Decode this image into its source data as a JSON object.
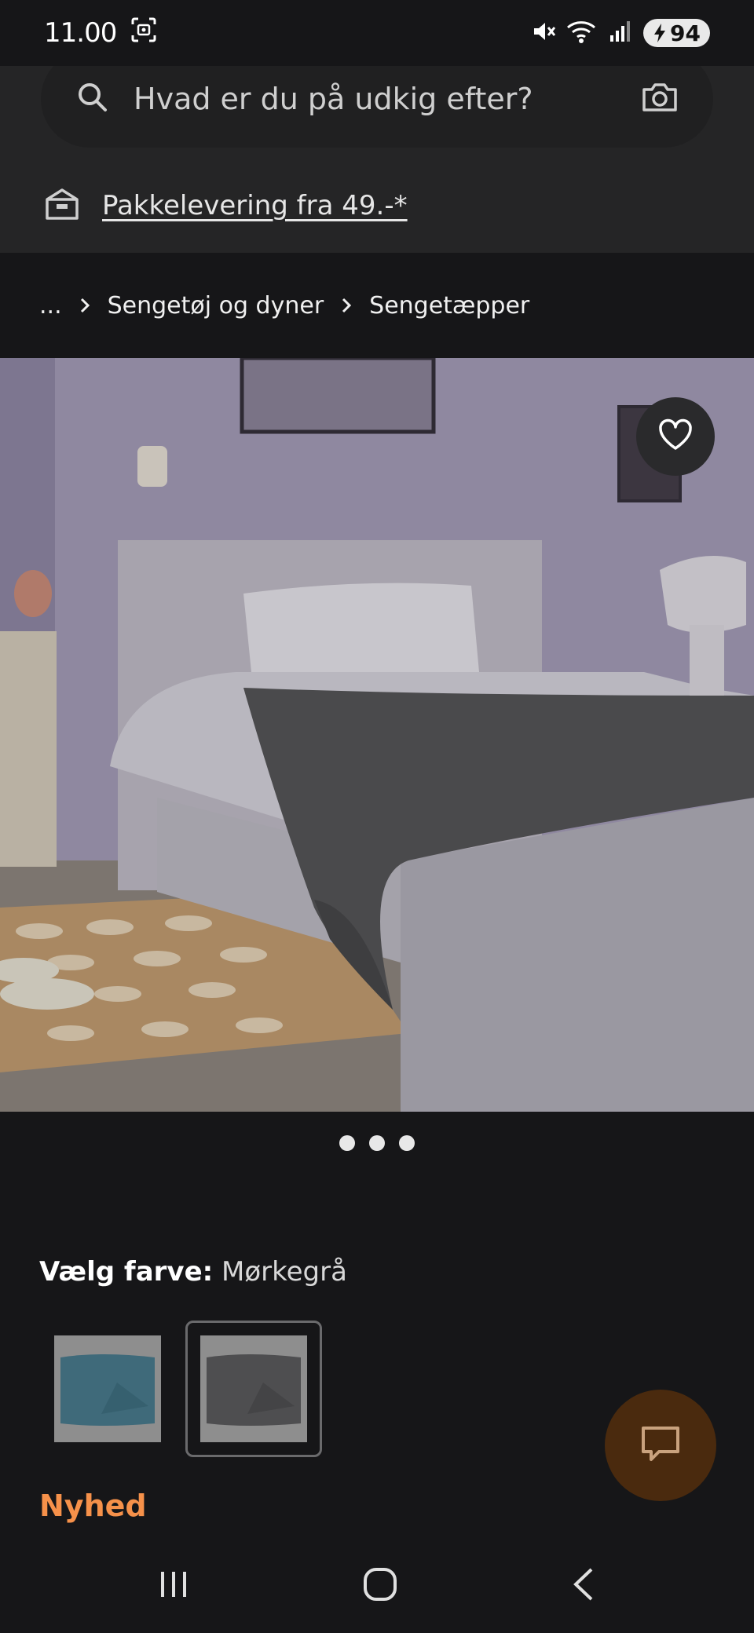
{
  "status_bar": {
    "time": "11.00",
    "battery": "94"
  },
  "search": {
    "placeholder": "Hvad er du på udkig efter?"
  },
  "delivery": {
    "text": "Pakkelevering fra 49.-*"
  },
  "breadcrumb": {
    "ellipsis": "...",
    "items": [
      "Sengetøj og dyner",
      "Sengetæpper"
    ]
  },
  "carousel": {
    "slide_count": 3,
    "active_index": 0
  },
  "color": {
    "label": "Vælg farve:",
    "selected": "Mørkegrå",
    "swatches": [
      {
        "color": "#3f6a7a",
        "selected": false
      },
      {
        "color": "#4e4e50",
        "selected": true
      }
    ]
  },
  "badge": {
    "text": "Nyhed"
  },
  "colors": {
    "accent_orange": "#f6914a",
    "chat_fab": "#4a2a0e",
    "background": "#161618"
  }
}
